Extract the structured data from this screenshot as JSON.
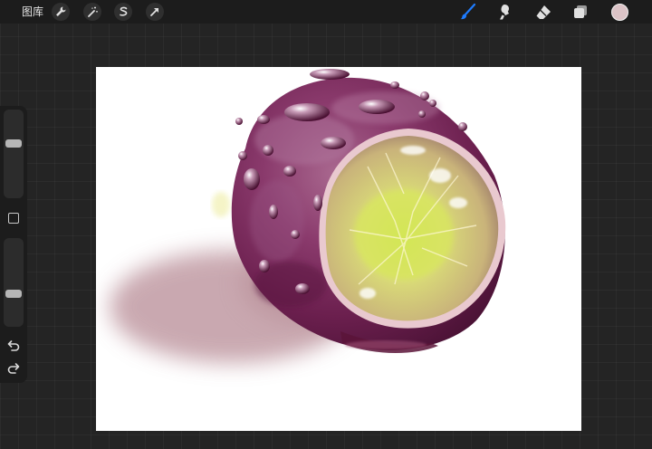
{
  "topbar": {
    "gallery_label": "图库",
    "left_tools": [
      "wrench-icon",
      "magic-wand-icon",
      "selection-icon",
      "transform-arrow-icon"
    ],
    "right_tools": [
      "brush-icon",
      "smudge-icon",
      "eraser-icon",
      "layers-icon"
    ],
    "active_tool": "brush-icon",
    "active_tool_color": "#1e7cff",
    "current_color": "#dbc3c6"
  },
  "sidebar": {
    "brush_size_level": 0.7,
    "opacity_level": 0.45,
    "controls": [
      "brush-size-slider",
      "modify-button",
      "opacity-slider",
      "undo-icon",
      "redo-icon"
    ]
  },
  "canvas": {
    "background": "#ffffff",
    "subject": "grape-with-water-drops"
  }
}
